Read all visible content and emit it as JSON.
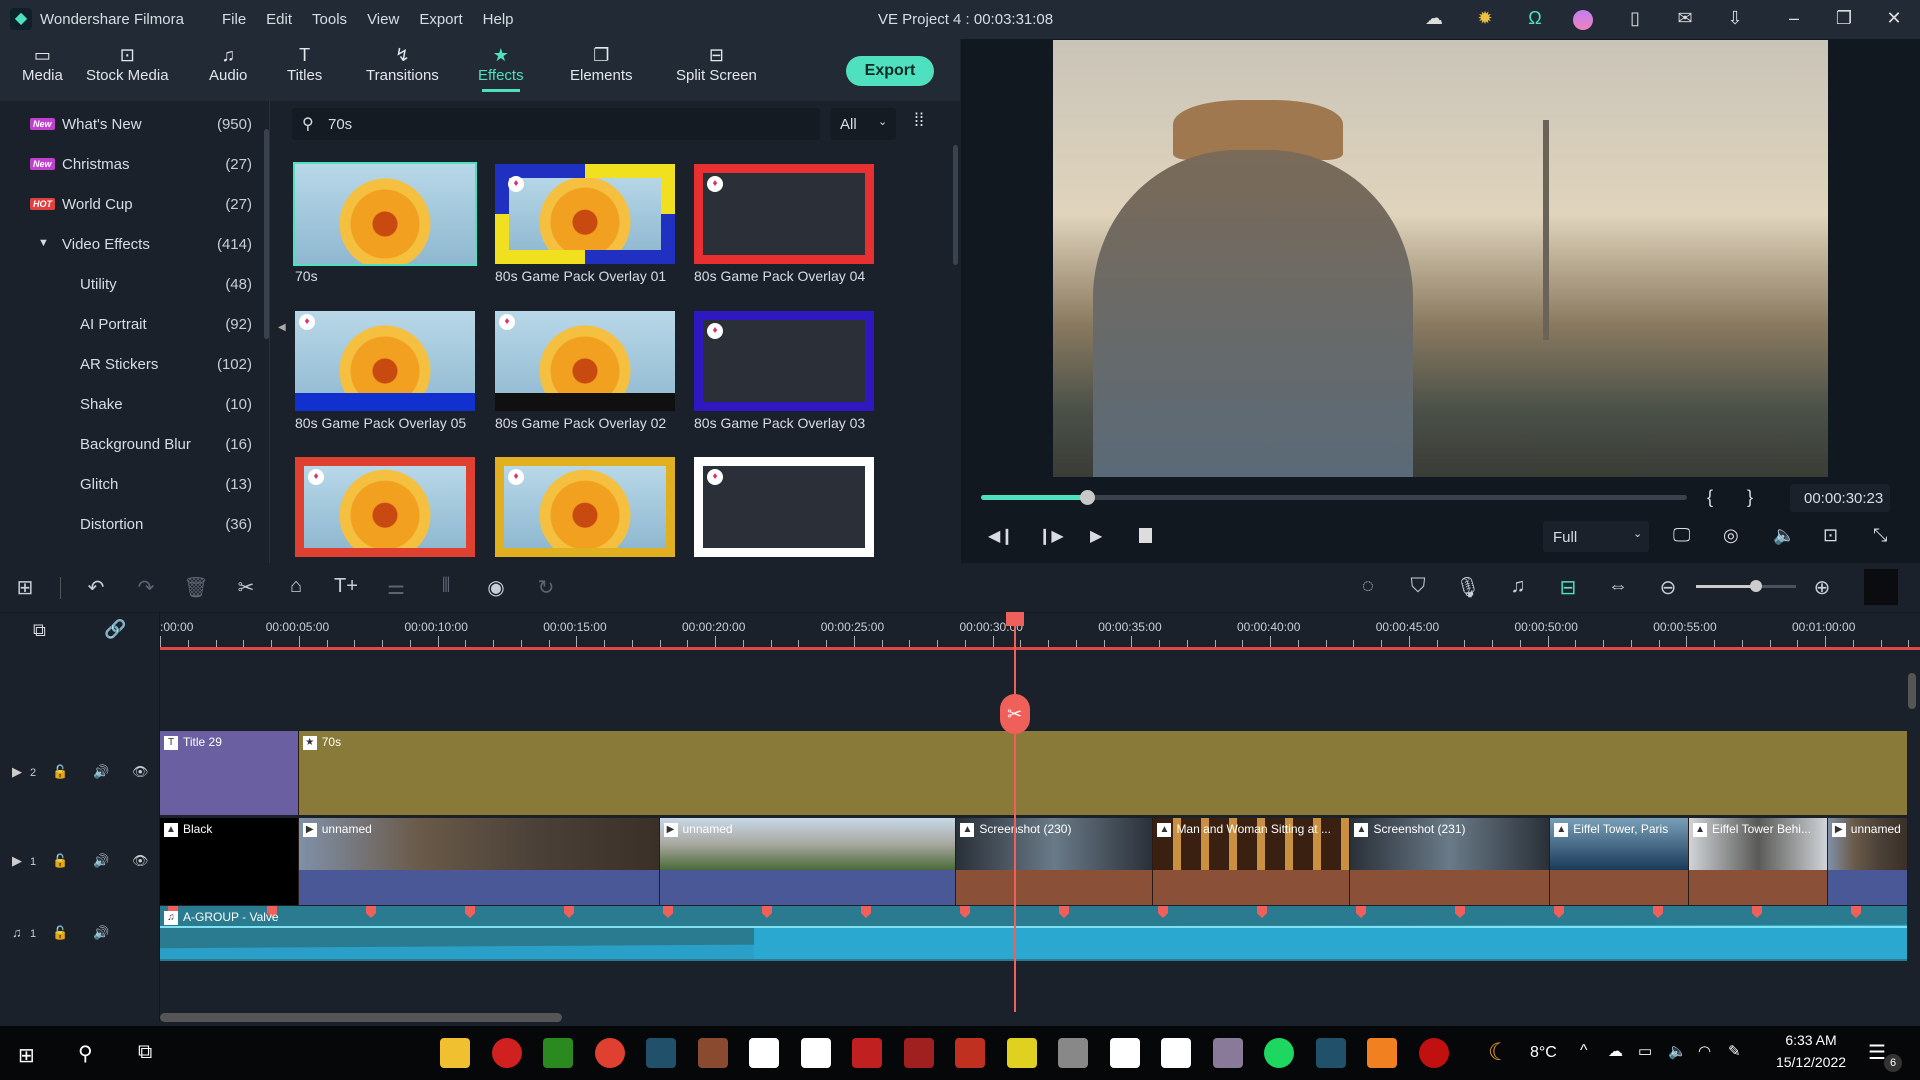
{
  "app": {
    "name": "Wondershare Filmora",
    "project_title": "VE Project 4 : 00:03:31:08"
  },
  "menu": [
    "File",
    "Edit",
    "Tools",
    "View",
    "Export",
    "Help"
  ],
  "title_icons": [
    "cloud-icon",
    "bulb-icon",
    "headset-icon",
    "avatar-icon",
    "save-icon",
    "mail-icon",
    "download-icon"
  ],
  "toolbar": {
    "tabs": [
      {
        "label": "Media",
        "icon": "folder"
      },
      {
        "label": "Stock Media",
        "icon": "stock"
      },
      {
        "label": "Audio",
        "icon": "music"
      },
      {
        "label": "Titles",
        "icon": "T"
      },
      {
        "label": "Transitions",
        "icon": "transition"
      },
      {
        "label": "Effects",
        "icon": "star",
        "active": true
      },
      {
        "label": "Elements",
        "icon": "elements"
      },
      {
        "label": "Split Screen",
        "icon": "split"
      }
    ],
    "export_label": "Export"
  },
  "sidebar": {
    "items": [
      {
        "label": "What's New",
        "count": "(950)",
        "badge": "New",
        "badge_color": "#c040d0"
      },
      {
        "label": "Christmas",
        "count": "(27)",
        "badge": "New",
        "badge_color": "#c040d0"
      },
      {
        "label": "World Cup",
        "count": "(27)",
        "badge": "HOT",
        "badge_color": "#e04040"
      },
      {
        "label": "Video Effects",
        "count": "(414)",
        "expanded": true
      },
      {
        "label": "Utility",
        "count": "(48)"
      },
      {
        "label": "AI Portrait",
        "count": "(92)"
      },
      {
        "label": "AR Stickers",
        "count": "(102)"
      },
      {
        "label": "Shake",
        "count": "(10)"
      },
      {
        "label": "Background Blur",
        "count": "(16)"
      },
      {
        "label": "Glitch",
        "count": "(13)"
      },
      {
        "label": "Distortion",
        "count": "(36)"
      }
    ]
  },
  "search": {
    "value": "70s",
    "filter": "All"
  },
  "effects": [
    {
      "label": "70s",
      "style": "plain",
      "selected": true
    },
    {
      "label": "80s Game Pack Overlay 01",
      "style": "checker"
    },
    {
      "label": "80s Game Pack Overlay 04",
      "style": "frame-red"
    },
    {
      "label": "80s Game Pack Overlay 05",
      "style": "game-blue"
    },
    {
      "label": "80s Game Pack Overlay 02",
      "style": "game-dots"
    },
    {
      "label": "80s Game Pack Overlay 03",
      "style": "frame-blue"
    },
    {
      "label": "",
      "style": "frame-orange"
    },
    {
      "label": "",
      "style": "frame-yellow"
    },
    {
      "label": "",
      "style": "frame-white"
    }
  ],
  "player": {
    "timecode": "00:00:30:23",
    "progress": 0.15,
    "quality": "Full",
    "mark_in": "{",
    "mark_out": "}"
  },
  "timeline": {
    "ruler": [
      ":00:00",
      "00:00:05:00",
      "00:00:10:00",
      "00:00:15:00",
      "00:00:20:00",
      "00:00:25:00",
      "00:00:30:00",
      "00:00:35:00",
      "00:00:40:00",
      "00:00:45:00",
      "00:00:50:00",
      "00:00:55:00",
      "00:01:00:00"
    ],
    "playhead_seconds": 30.8,
    "zoom_level": 0.6,
    "tracks": [
      {
        "label": "2",
        "type": "video",
        "clips": [
          {
            "name": "Title 29",
            "start": 0,
            "end": 5,
            "kind": "title"
          },
          {
            "name": "70s",
            "start": 5,
            "end": 63,
            "kind": "effect"
          }
        ]
      },
      {
        "label": "1",
        "type": "video",
        "clips": [
          {
            "name": "Black",
            "start": 0,
            "end": 5,
            "kind": "black"
          },
          {
            "name": "unnamed",
            "start": 5,
            "end": 18,
            "kind": "video"
          },
          {
            "name": "unnamed",
            "start": 18,
            "end": 28.7,
            "kind": "video2"
          },
          {
            "name": "Screenshot (230)",
            "start": 28.7,
            "end": 35.8,
            "kind": "image"
          },
          {
            "name": "Man and Woman Sitting at ...",
            "start": 35.8,
            "end": 42.9,
            "kind": "image2"
          },
          {
            "name": "Screenshot (231)",
            "start": 42.9,
            "end": 50.1,
            "kind": "image"
          },
          {
            "name": "Eiffel Tower, Paris",
            "start": 50.1,
            "end": 55.1,
            "kind": "image3"
          },
          {
            "name": "Eiffel Tower Behi...",
            "start": 55.1,
            "end": 60.1,
            "kind": "image4"
          },
          {
            "name": "unnamed",
            "start": 60.1,
            "end": 63,
            "kind": "video"
          }
        ]
      },
      {
        "label": "1",
        "type": "audio",
        "clips": [
          {
            "name": "A-GROUP - Valve",
            "start": 0,
            "end": 63,
            "kind": "audio"
          }
        ]
      }
    ]
  },
  "taskbar": {
    "weather": "8°C",
    "time": "6:33 AM",
    "date": "15/12/2022",
    "notifications": "6"
  },
  "colors": {
    "accent": "#4fe0c0",
    "playhead": "#f0605a",
    "title_clip": "#6a5fa0",
    "effect_clip": "#8a7a3a",
    "video_clip": "#4a5898",
    "image_clip": "#8a5038",
    "audio_clip": "#2aa0c8"
  }
}
